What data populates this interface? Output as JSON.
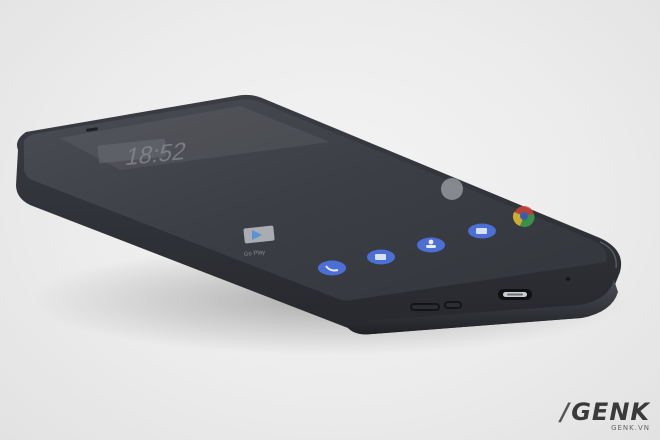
{
  "scene": {
    "subject": "phone-on-table",
    "screen": {
      "clock": "18:52",
      "app_label": "Go Play"
    }
  },
  "watermark": {
    "logo": "GENK",
    "url": "GENK.VN"
  },
  "colors": {
    "background": "#ececec",
    "phone_body": "#2e3036",
    "screen_off": "#3a3d43",
    "dock_icon": "#4c6fd6"
  }
}
